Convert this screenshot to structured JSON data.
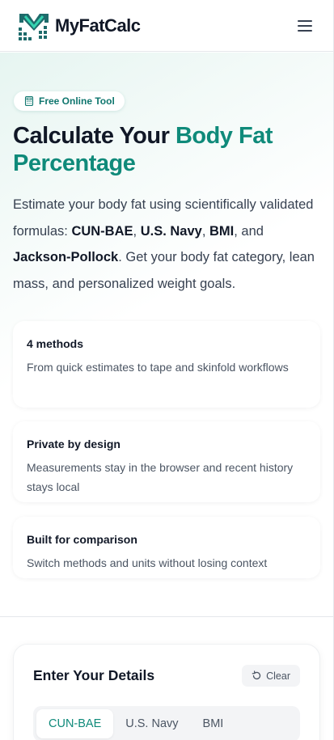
{
  "header": {
    "brand_name": "MyFatCalc",
    "logo_icon": "bar-chart-logo-icon",
    "menu_icon": "hamburger-menu-icon"
  },
  "colors": {
    "brand_dark": "#1e6b6b",
    "accent": "#0f8a7a",
    "text": "#111827"
  },
  "hero": {
    "badge": "Free Online Tool",
    "title_main": "Calculate Your ",
    "title_accent": "Body Fat Percentage",
    "desc": {
      "p1": "Estimate your body fat using scientifically validated formulas: ",
      "m1": "CUN-BAE",
      "s1": ", ",
      "m2": "U.S. Navy",
      "s2": ", ",
      "m3": "BMI",
      "s3": ", and ",
      "m4": "Jackson-Pollock",
      "p2": ". Get your body fat category, lean mass, and personalized weight goals."
    },
    "cards": [
      {
        "title": "4 methods",
        "text": "From quick estimates to tape and skinfold workflows"
      },
      {
        "title": "Private by design",
        "text": "Measurements stay in the browser and recent history stays local"
      },
      {
        "title": "Built for comparison",
        "text": "Switch methods and units without losing context"
      }
    ]
  },
  "calculator": {
    "title": "Enter Your Details",
    "clear_label": "Clear",
    "tabs": [
      {
        "label": "CUN-BAE",
        "active": true
      },
      {
        "label": "U.S. Navy",
        "active": false
      },
      {
        "label": "BMI",
        "active": false
      }
    ]
  }
}
